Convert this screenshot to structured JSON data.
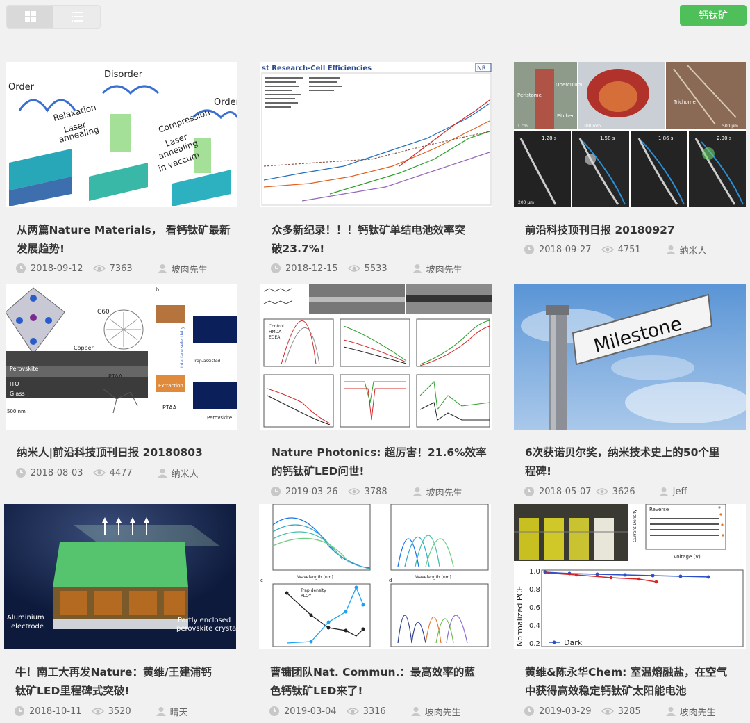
{
  "toolbar": {
    "grid_icon": "grid-icon",
    "list_icon": "list-icon",
    "tag_label": "钙钛矿",
    "accent": "#4fbf5a"
  },
  "cards": [
    {
      "title_line1": "从两篇Nature Materials， 看钙钛矿最新",
      "title_line2": "发展趋势!",
      "date": "2018-09-12",
      "views": "7363",
      "author": "坡肉先生",
      "thumb_text": {
        "t1": "Order",
        "t2": "Disorder",
        "t3": "Order",
        "t4": "Relaxation",
        "t5": "Laser",
        "t6": "annealing",
        "t7": "Compression",
        "t8": "Laser",
        "t9": "annealing",
        "t10": "in vaccum"
      }
    },
    {
      "title_line1": "众多新纪录！！！钙钛矿单结电池效率突",
      "title_line2": "破23.7%!",
      "date": "2018-12-15",
      "views": "5533",
      "author": "坡肉先生",
      "thumb_text": {
        "t1": "st Research-Cell Efficiencies",
        "t2": "NR"
      }
    },
    {
      "title_line1": "前沿科技顶刊日报 20180927",
      "title_line2": "",
      "date": "2018-09-27",
      "views": "4751",
      "author": "纳米人",
      "thumb_text": {
        "t1": "Peristome",
        "t2": "Operculum",
        "t3": "Pitcher",
        "t4": "Trichome",
        "t5": "1.28 s",
        "t6": "1.58 s",
        "t7": "1.86 s",
        "t8": "2.90 s",
        "t9": "200 μm",
        "t10": "1 cm",
        "t11": "300 mm",
        "t12": "500 μm"
      }
    },
    {
      "title_line1": "纳米人|前沿科技顶刊日报 20180803",
      "title_line2": "",
      "date": "2018-08-03",
      "views": "4477",
      "author": "纳米人",
      "thumb_text": {
        "t1": "C60",
        "t2": "Copper",
        "t3": "Perovskite",
        "t4": "ITO",
        "t5": "Glass",
        "t6": "PTAA",
        "t7": "500 nm",
        "t8": "b",
        "t9": "Extraction",
        "t10": "PTAA",
        "t11": "Perovskite",
        "t12": "Trap-assisted",
        "t13": "Interface selectivity"
      }
    },
    {
      "title_line1": "Nature Photonics: 超厉害！21.6%效率",
      "title_line2": "的钙钛矿LED问世!",
      "date": "2019-03-26",
      "views": "3788",
      "author": "坡肉先生",
      "thumb_text": {
        "t1": "Control",
        "t2": "HMDA",
        "t3": "EDEA"
      }
    },
    {
      "title_line1": "6次获诺贝尔奖，纳米技术史上的50个里",
      "title_line2": "程碑!",
      "date": "2018-05-07",
      "views": "3626",
      "author": "Jeff",
      "thumb_text": {
        "t1": "Milestone"
      }
    },
    {
      "title_line1": "牛！南工大再发Nature：黄维/王建浦钙",
      "title_line2": "钛矿LED里程碑式突破!",
      "date": "2018-10-11",
      "views": "3520",
      "author": "晴天",
      "thumb_text": {
        "t1": "Aluminium",
        "t2": "electrode",
        "t3": "Partly enclosed",
        "t4": "perovskite crystal"
      }
    },
    {
      "title_line1": "曹镛团队Nat. Commun.：最高效率的蓝",
      "title_line2": "色钙钛矿LED来了!",
      "date": "2019-03-04",
      "views": "3316",
      "author": "坡肉先生",
      "thumb_text": {
        "t1": "Wavelength (nm)",
        "t2": "Wavelength (nm)",
        "t3": "Trap density",
        "t4": "PLQY",
        "t5": "c",
        "t6": "d"
      }
    },
    {
      "title_line1": "黄维&陈永华Chem: 室温熔融盐，在空气",
      "title_line2": "中获得高效稳定钙钛矿太阳能电池",
      "date": "2019-03-29",
      "views": "3285",
      "author": "坡肉先生",
      "thumb_text": {
        "t1": "Reverse",
        "t2": "Normalized PCE",
        "t3": "Dark",
        "t4": "Voltage (V)",
        "t5": "Current Density",
        "t6": "1.0",
        "t7": "0.8",
        "t8": "0.6",
        "t9": "0.4",
        "t10": "0.2"
      }
    }
  ]
}
